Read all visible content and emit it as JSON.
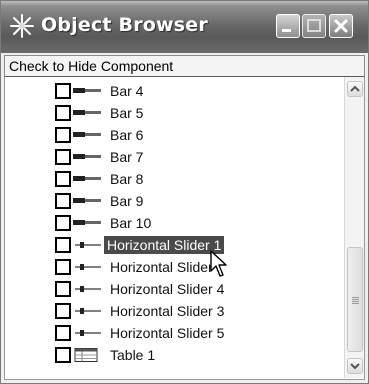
{
  "window": {
    "title": "Object Browser",
    "icon": "sparkle-app-icon",
    "controls": [
      "minimize-button",
      "maximize-button",
      "close-button"
    ]
  },
  "header": {
    "label": "Check to Hide Component"
  },
  "items": [
    {
      "label": "Bar 4",
      "icon": "bar-icon",
      "checked": false,
      "selected": false
    },
    {
      "label": "Bar 5",
      "icon": "bar-icon",
      "checked": false,
      "selected": false
    },
    {
      "label": "Bar 6",
      "icon": "bar-icon",
      "checked": false,
      "selected": false
    },
    {
      "label": "Bar 7",
      "icon": "bar-icon",
      "checked": false,
      "selected": false
    },
    {
      "label": "Bar 8",
      "icon": "bar-icon",
      "checked": false,
      "selected": false
    },
    {
      "label": "Bar 9",
      "icon": "bar-icon",
      "checked": false,
      "selected": false
    },
    {
      "label": "Bar 10",
      "icon": "bar-icon",
      "checked": false,
      "selected": false
    },
    {
      "label": "Horizontal Slider 1",
      "icon": "slider-icon",
      "checked": false,
      "selected": true
    },
    {
      "label": "Horizontal Slider",
      "icon": "slider-icon",
      "checked": false,
      "selected": false
    },
    {
      "label": "Horizontal Slider 4",
      "icon": "slider-icon",
      "checked": false,
      "selected": false
    },
    {
      "label": "Horizontal Slider 3",
      "icon": "slider-icon",
      "checked": false,
      "selected": false
    },
    {
      "label": "Horizontal Slider 5",
      "icon": "slider-icon",
      "checked": false,
      "selected": false
    },
    {
      "label": "Table 1",
      "icon": "table-icon",
      "checked": false,
      "selected": false
    }
  ],
  "scrollbar": {
    "position": 0.78,
    "visible_fraction": 0.42
  },
  "colors": {
    "selection": "#4a4a4a",
    "titlebar": "#5f5f5f"
  }
}
